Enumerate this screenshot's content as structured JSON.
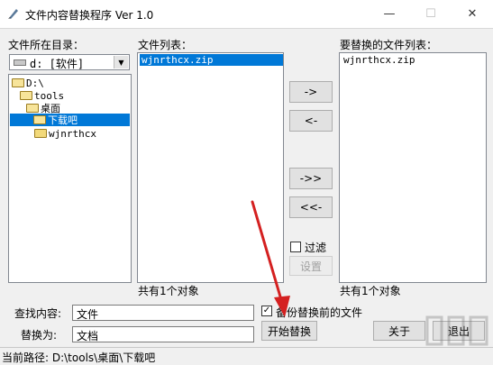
{
  "window": {
    "title": "文件内容替换程序 Ver 1.0",
    "minimize_glyph": "—",
    "maximize_glyph": "☐",
    "close_glyph": "✕"
  },
  "left_panel": {
    "label": "文件所在目录：",
    "drive_select": "d: [软件]",
    "tree": [
      {
        "label": "D:\\",
        "selected": false
      },
      {
        "label": "tools",
        "selected": false
      },
      {
        "label": "桌面",
        "selected": false
      },
      {
        "label": "下载吧",
        "selected": true
      },
      {
        "label": "wjnrthcx",
        "selected": false
      }
    ]
  },
  "file_list": {
    "label": "文件列表：",
    "items": [
      "wjnrthcx.zip"
    ],
    "count_text": "共有1个对象"
  },
  "transfer_buttons": {
    "add": "->",
    "remove": "<-",
    "add_all": "->>",
    "remove_all": "<<-"
  },
  "filter": {
    "label": "过滤",
    "checked": false,
    "settings_button": "设置"
  },
  "replace_list": {
    "label": "要替换的文件列表：",
    "items": [
      "wjnrthcx.zip"
    ],
    "count_text": "共有1个对象"
  },
  "form": {
    "find_label": "查找内容:",
    "find_value": "文件",
    "replace_label": "替换为:",
    "replace_value": "文档",
    "backup_label": "备份替换前的文件",
    "backup_checked": true,
    "start_button": "开始替换",
    "about_button": "关于",
    "exit_button": "退出"
  },
  "status_bar": {
    "path": "当前路径: D:\\tools\\桌面\\下载吧"
  },
  "colors": {
    "selection": "#0078d7",
    "annotation_arrow": "#d42020"
  }
}
